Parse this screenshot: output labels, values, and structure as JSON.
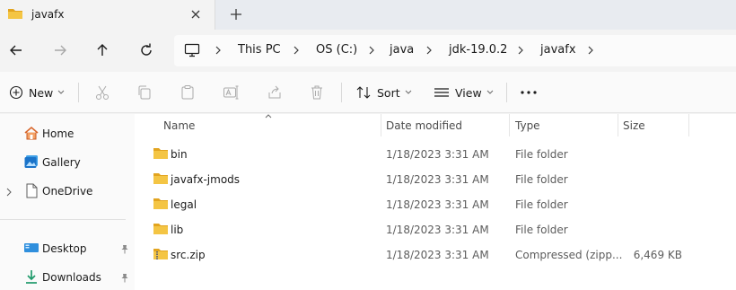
{
  "window": {
    "tab_title": "javafx"
  },
  "address": {
    "crumbs": [
      "This PC",
      "OS (C:)",
      "java",
      "jdk-19.0.2",
      "javafx"
    ]
  },
  "commands": {
    "new_label": "New",
    "sort_label": "Sort",
    "view_label": "View"
  },
  "nav": {
    "items": [
      {
        "label": "Home",
        "icon": "home-icon"
      },
      {
        "label": "Gallery",
        "icon": "gallery-icon"
      },
      {
        "label": "OneDrive",
        "icon": "onedrive-icon"
      },
      {
        "label": "Desktop",
        "icon": "desktop-icon"
      },
      {
        "label": "Downloads",
        "icon": "downloads-icon"
      }
    ]
  },
  "columns": {
    "name": "Name",
    "date": "Date modified",
    "type": "Type",
    "size": "Size"
  },
  "files": [
    {
      "name": "bin",
      "date": "1/18/2023 3:31 AM",
      "type": "File folder",
      "size": "",
      "icon": "folder-icon"
    },
    {
      "name": "javafx-jmods",
      "date": "1/18/2023 3:31 AM",
      "type": "File folder",
      "size": "",
      "icon": "folder-icon"
    },
    {
      "name": "legal",
      "date": "1/18/2023 3:31 AM",
      "type": "File folder",
      "size": "",
      "icon": "folder-icon"
    },
    {
      "name": "lib",
      "date": "1/18/2023 3:31 AM",
      "type": "File folder",
      "size": "",
      "icon": "folder-icon"
    },
    {
      "name": "src.zip",
      "date": "1/18/2023 3:31 AM",
      "type": "Compressed (zipp...",
      "size": "6,469 KB",
      "icon": "zip-folder-icon"
    }
  ],
  "colors": {
    "folder": "#f4c544",
    "folder_dark": "#e2a41f",
    "accent": "#0067c0"
  }
}
